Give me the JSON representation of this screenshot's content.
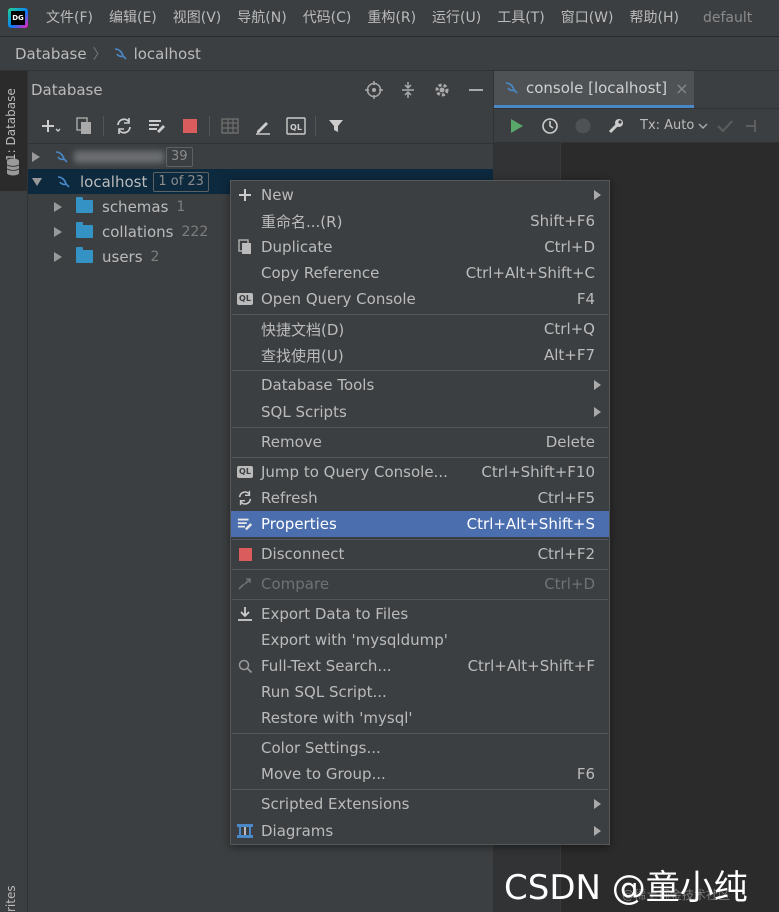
{
  "app": {
    "logo_text": "DG",
    "menu": [
      "文件(F)",
      "编辑(E)",
      "视图(V)",
      "导航(N)",
      "代码(C)",
      "重构(R)",
      "运行(U)",
      "工具(T)",
      "窗口(W)",
      "帮助(H)"
    ],
    "title_fragment": "default"
  },
  "breadcrumb": [
    "Database",
    "localhost"
  ],
  "left_strip": {
    "database_tab": "1: Database",
    "favorites_tab": "rites"
  },
  "panel": {
    "title": "Database",
    "header_icons": [
      "target-icon",
      "collapse-icon",
      "gear-icon",
      "minimize-icon"
    ],
    "toolbar_icons": [
      "add-icon",
      "duplicate-icon",
      "refresh-icon",
      "properties-icon",
      "stop-icon",
      "table-icon",
      "edit-icon",
      "query-console-icon",
      "filter-icon"
    ]
  },
  "tree": {
    "rows": [
      {
        "label": "",
        "count": "39",
        "blurred": true
      },
      {
        "label": "localhost",
        "badge": "1 of 23",
        "selected": true
      },
      {
        "label": "schemas",
        "count": "1"
      },
      {
        "label": "collations",
        "count": "222"
      },
      {
        "label": "users",
        "count": "2"
      }
    ]
  },
  "console": {
    "tab_label": "console [localhost]",
    "tab_close": "×",
    "tx_label": "Tx: Auto"
  },
  "context_menu": {
    "items": [
      {
        "label": "New",
        "shortcut": "",
        "submenu": true,
        "icon": "plus-icon"
      },
      {
        "label": "重命名...(R)",
        "shortcut": "Shift+F6"
      },
      {
        "label": "Duplicate",
        "shortcut": "Ctrl+D",
        "icon": "duplicate-icon"
      },
      {
        "label": "Copy Reference",
        "shortcut": "Ctrl+Alt+Shift+C"
      },
      {
        "label": "Open Query Console",
        "shortcut": "F4",
        "icon": "query-console-icon"
      },
      {
        "label": "快捷文档(D)",
        "shortcut": "Ctrl+Q"
      },
      {
        "label": "查找使用(U)",
        "shortcut": "Alt+F7"
      },
      {
        "label": "Database Tools",
        "shortcut": "",
        "submenu": true
      },
      {
        "label": "SQL Scripts",
        "shortcut": "",
        "submenu": true
      },
      {
        "label": "Remove",
        "shortcut": "Delete"
      },
      {
        "label": "Jump to Query Console...",
        "shortcut": "Ctrl+Shift+F10",
        "icon": "query-console-icon"
      },
      {
        "label": "Refresh",
        "shortcut": "Ctrl+F5",
        "icon": "refresh-icon"
      },
      {
        "label": "Properties",
        "shortcut": "Ctrl+Alt+Shift+S",
        "icon": "properties-icon",
        "highlighted": true
      },
      {
        "label": "Disconnect",
        "shortcut": "Ctrl+F2",
        "icon": "stop-icon"
      },
      {
        "label": "Compare",
        "shortcut": "Ctrl+D",
        "icon": "compare-icon",
        "disabled": true
      },
      {
        "label": "Export Data to Files",
        "shortcut": "",
        "icon": "export-icon"
      },
      {
        "label": "Export with 'mysqldump'",
        "shortcut": ""
      },
      {
        "label": "Full-Text Search...",
        "shortcut": "Ctrl+Alt+Shift+F",
        "icon": "search-icon"
      },
      {
        "label": "Run SQL Script...",
        "shortcut": ""
      },
      {
        "label": "Restore with 'mysql'",
        "shortcut": ""
      },
      {
        "label": "Color Settings...",
        "shortcut": ""
      },
      {
        "label": "Move to Group...",
        "shortcut": "F6"
      },
      {
        "label": "Scripted Extensions",
        "shortcut": "",
        "submenu": true
      },
      {
        "label": "Diagrams",
        "shortcut": "",
        "submenu": true,
        "icon": "diagram-icon"
      }
    ]
  },
  "colors": {
    "background": "#2b2b2b",
    "panel": "#3c3f41",
    "selection": "#0d293e",
    "menu_highlight": "#4b6eaf",
    "folder": "#3592c4",
    "run_green": "#59a869",
    "stop_red": "#db5c5c"
  },
  "watermark": {
    "text": "CSDN @童小纯",
    "faint": "@稀土掘金技术社区"
  }
}
